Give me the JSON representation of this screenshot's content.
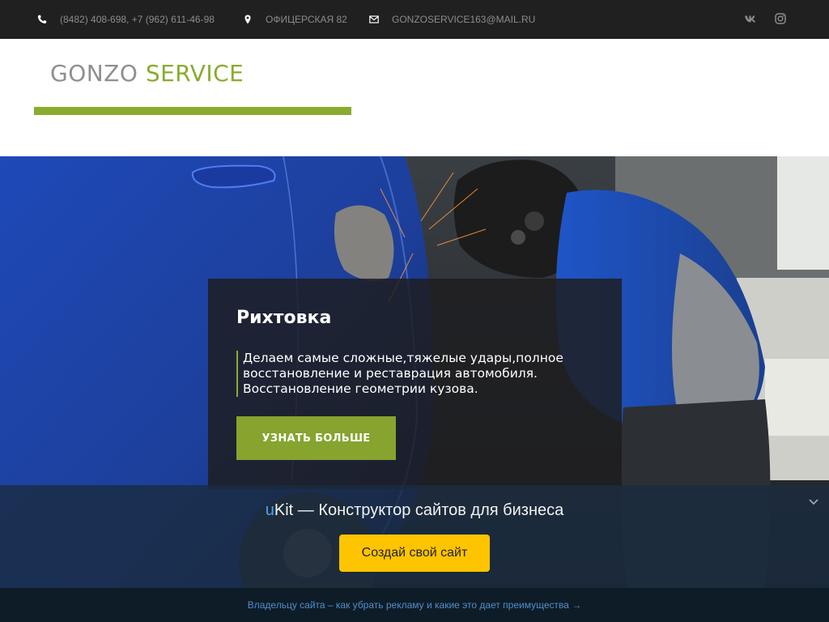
{
  "topbar": {
    "phone": "(8482) 408-698, +7 (962) 611-46-98",
    "address": "ОФИЦЕРСКАЯ 82",
    "email": "GONZOSERVICE163@MAIL.RU",
    "icons": [
      "phone-icon",
      "map-pin-icon",
      "mail-icon",
      "vk-icon",
      "instagram-icon"
    ]
  },
  "header": {
    "logo_word1": "GONZO",
    "logo_word2": "SERVICE"
  },
  "hero": {
    "title": "Рихтовка",
    "text": "Делаем самые сложные,тяжелые удары,полное восстановление и реставрация автомобиля. Восстановление геометрии кузова.",
    "button_label": "УЗНАТЬ БОЛЬШЕ"
  },
  "promo": {
    "title_prefix": "u",
    "title_rest": "Kit — Конструктор сайтов для бизнеса",
    "button_label": "Создай свой сайт",
    "footer_link": "Владельцу сайта – как убрать рекламу и какие это дает преимущества →"
  },
  "colors": {
    "accent_green": "#8aab2e",
    "topbar_bg": "#202020",
    "promo_button": "#ffc400",
    "ukit_blue": "#4aa3ff"
  }
}
